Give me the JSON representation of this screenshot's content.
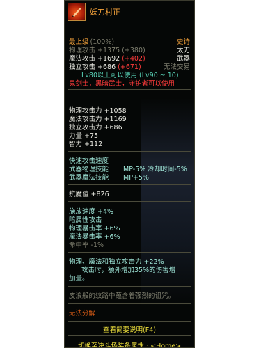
{
  "item": {
    "name": "妖刀村正",
    "grade_label": "最上级",
    "grade_pct": "(100%)",
    "rarity": "史诗",
    "phys_atk_label": "物理攻击",
    "phys_atk_value": "+1375",
    "phys_atk_base": "(+380)",
    "weapon_type": "太刀",
    "mag_atk_label": "魔法攻击",
    "mag_atk_value": "+1692",
    "mag_atk_base": "(+402)",
    "category": "武器",
    "ind_atk_label": "独立攻击",
    "ind_atk_value": "+686",
    "ind_atk_base": "(+671)",
    "trade": "无法交易",
    "level_req": "Lv80以上可以使用",
    "level_range": "(Lv90 ~ 10)",
    "classes": "鬼剑士，黑暗武士，守护者可以使用"
  },
  "stats": [
    {
      "label": "物理攻击力",
      "value": "+1058"
    },
    {
      "label": "魔法攻击力",
      "value": "+1169"
    },
    {
      "label": "独立攻击力",
      "value": "+686"
    },
    {
      "label": "力量",
      "value": "+75"
    },
    {
      "label": "智力",
      "value": "+112"
    }
  ],
  "weapon_skills": {
    "speed_label": "快速攻击速度",
    "phys_skill_label": "武器物理技能",
    "phys_skill_value": "MP-5% 冷却时间-5%",
    "mag_skill_label": "武器魔法技能",
    "mag_skill_value": "MP+5%"
  },
  "anti_magic": {
    "label": "抗魔值",
    "value": "+826"
  },
  "secondary": [
    {
      "label": "施放速度",
      "value": "+4%"
    },
    {
      "label": "暗属性攻击",
      "value": ""
    },
    {
      "label": "物理暴击率",
      "value": "+6%"
    },
    {
      "label": "魔法暴击率",
      "value": "+6%"
    },
    {
      "label": "命中率",
      "value": "-1%"
    }
  ],
  "special": {
    "line1": "物理、魔法和独立攻击力 +22%",
    "line2": "攻击时，额外增加35%的伤害增",
    "line3": "加量。"
  },
  "flavor": "皮浪般的纹路中蕴含着强烈的诅咒。",
  "no_repair": "无法分解",
  "footer": {
    "help": "查看简要说明(F4)",
    "switch": "切换至决斗场装备属性 : <Home>"
  },
  "colors": {
    "name": "#f6a33b",
    "epic": "#f6a33b",
    "stat_green": "#3ee840",
    "warning_red": "#ff3b3b",
    "skill_cyan": "#9fe6d8",
    "footer_yellow": "#f3e43e"
  }
}
